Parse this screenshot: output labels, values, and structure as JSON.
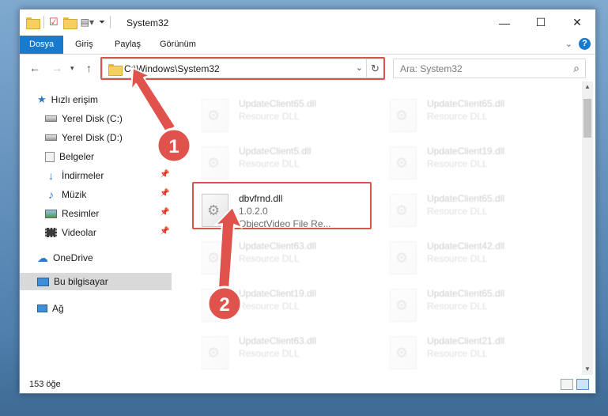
{
  "window": {
    "title": "System32",
    "controls": [
      "—",
      "☐",
      "✕"
    ]
  },
  "ribbon": {
    "tabs": [
      "Dosya",
      "Giriş",
      "Paylaş",
      "Görünüm"
    ],
    "active_tab": "Dosya"
  },
  "navbar": {
    "address": "C:\\Windows\\System32",
    "search_placeholder": "Ara: System32"
  },
  "sidebar": {
    "items": [
      {
        "label": "Hızlı erişim",
        "icon": "star-icon"
      },
      {
        "label": "Yerel Disk (C:)",
        "icon": "drive-icon",
        "pinned": true
      },
      {
        "label": "Yerel Disk (D:)",
        "icon": "drive-icon",
        "pinned": true
      },
      {
        "label": "Belgeler",
        "icon": "documents-icon",
        "pinned": true
      },
      {
        "label": "İndirmeler",
        "icon": "download-icon",
        "pinned": true
      },
      {
        "label": "Müzik",
        "icon": "music-icon",
        "pinned": true
      },
      {
        "label": "Resimler",
        "icon": "pictures-icon",
        "pinned": true
      },
      {
        "label": "Videolar",
        "icon": "videos-icon",
        "pinned": true
      },
      {
        "label": "OneDrive",
        "icon": "cloud-icon"
      },
      {
        "label": "Bu bilgisayar",
        "icon": "computer-icon",
        "selected": true
      },
      {
        "label": "Ağ",
        "icon": "network-icon"
      }
    ]
  },
  "files": [
    {
      "name": "UpdateClient65.dll",
      "type": "Resource DLL"
    },
    {
      "name": "UpdateClient65.dll",
      "type": "Resource DLL"
    },
    {
      "name": "UpdateClient5.dll",
      "type": "Resource DLL"
    },
    {
      "name": "UpdateClient19.dll",
      "type": "Resource DLL"
    },
    {
      "name": "dbvfrnd.dll",
      "version": "1.0.2.0",
      "desc": "ObjectVideo File Re...",
      "highlighted": true
    },
    {
      "name": "UpdateClient65.dll",
      "type": "Resource DLL"
    },
    {
      "name": "UpdateClient63.dll",
      "type": "Resource DLL"
    },
    {
      "name": "UpdateClient42.dll",
      "type": "Resource DLL"
    },
    {
      "name": "UpdateClient19.dll",
      "type": "Resource DLL"
    },
    {
      "name": "UpdateClient65.dll",
      "type": "Resource DLL"
    },
    {
      "name": "UpdateClient63.dll",
      "type": "Resource DLL"
    },
    {
      "name": "UpdateClient21.dll",
      "type": "Resource DLL"
    }
  ],
  "status": {
    "item_count": "153 öğe"
  },
  "annotations": {
    "step1": "1",
    "step2": "2",
    "color": "#e0524c"
  }
}
